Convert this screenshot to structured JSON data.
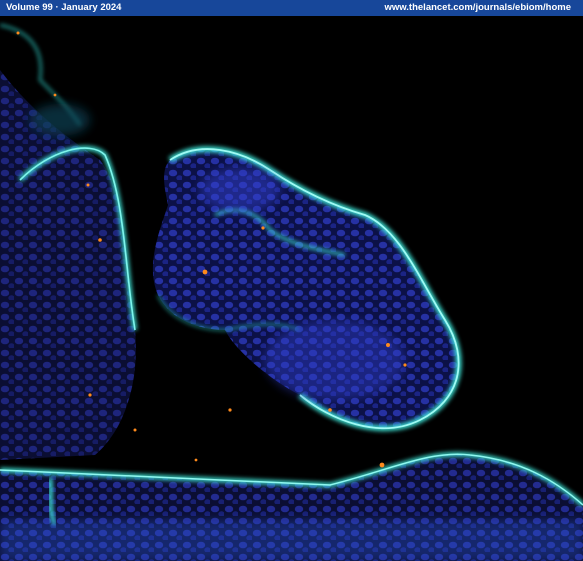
{
  "header": {
    "volume_label": "Volume 99 · January 2024",
    "url_label": "www.thelancet.com/journals/ebiom/home"
  },
  "image": {
    "subject": "fluorescence-micrograph",
    "colors": {
      "background": "#000000",
      "header_bar": "#17479a",
      "membrane_cyan": "#3ee3d6",
      "nuclei_blue": "#2f3ec8",
      "spots_orange": "#ff8a1c"
    }
  }
}
